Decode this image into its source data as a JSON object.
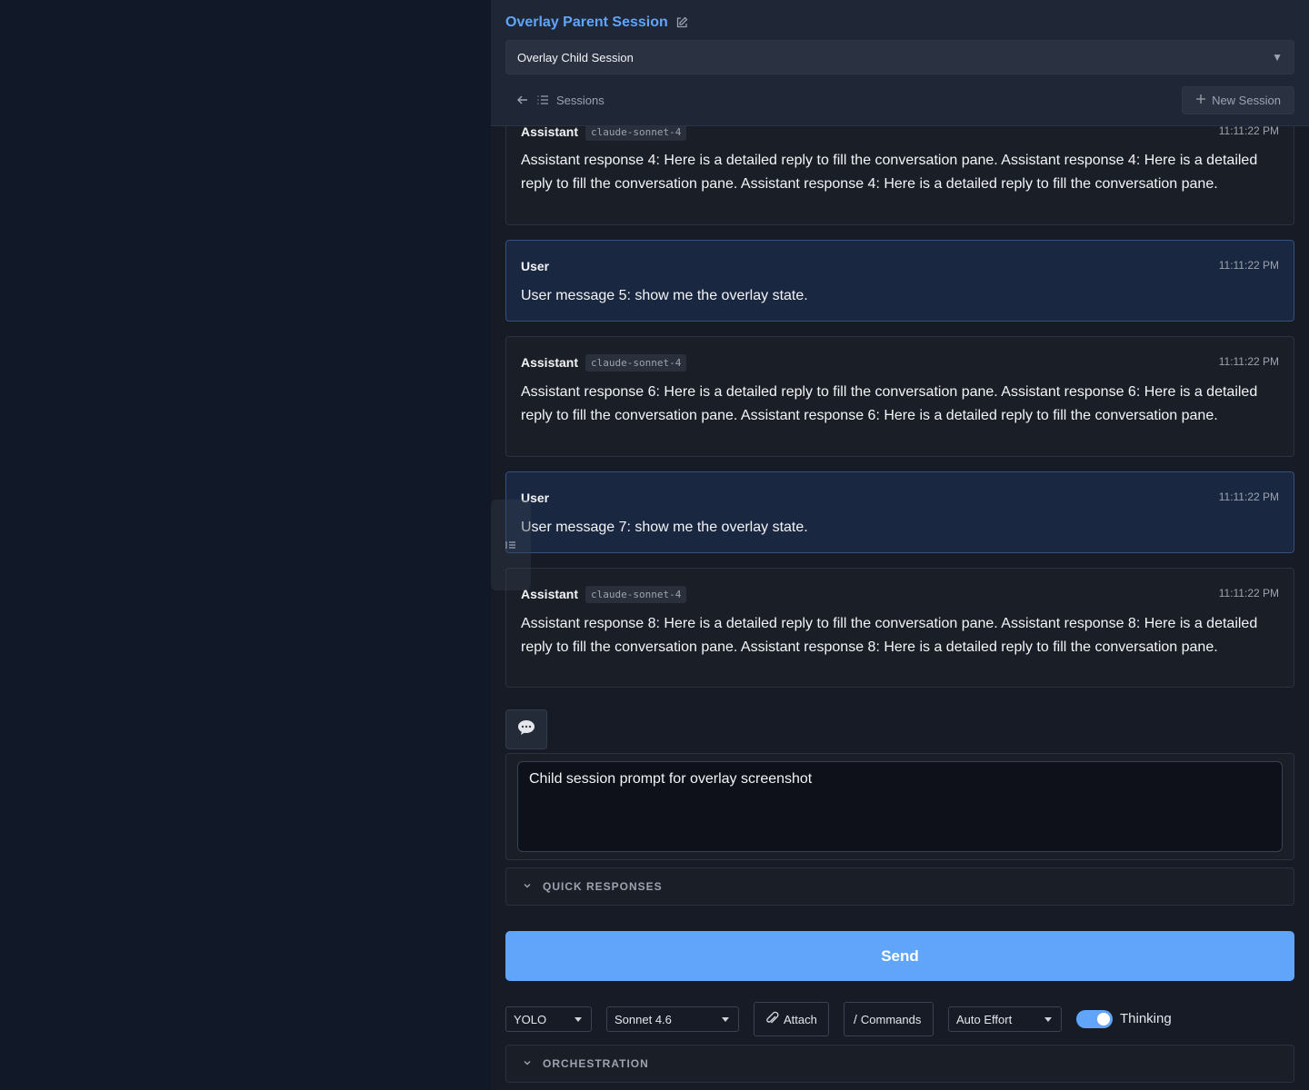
{
  "header": {
    "title": "Overlay Parent Session",
    "selected_session": "Overlay Child Session",
    "sessions_label": "Sessions",
    "new_session_label": "New Session"
  },
  "messages": [
    {
      "role": "Assistant",
      "model": "claude-sonnet-4",
      "time": "11:11:22 PM",
      "text": "Assistant response 4: Here is a detailed reply to fill the conversation pane. Assistant response 4: Here is a detailed reply to fill the conversation pane. Assistant response 4: Here is a detailed reply to fill the conversation pane."
    },
    {
      "role": "User",
      "time": "11:11:22 PM",
      "text": "User message 5: show me the overlay state."
    },
    {
      "role": "Assistant",
      "model": "claude-sonnet-4",
      "time": "11:11:22 PM",
      "text": "Assistant response 6: Here is a detailed reply to fill the conversation pane. Assistant response 6: Here is a detailed reply to fill the conversation pane. Assistant response 6: Here is a detailed reply to fill the conversation pane."
    },
    {
      "role": "User",
      "time": "11:11:22 PM",
      "text": "User message 7: show me the overlay state."
    },
    {
      "role": "Assistant",
      "model": "claude-sonnet-4",
      "time": "11:11:22 PM",
      "text": "Assistant response 8: Here is a detailed reply to fill the conversation pane. Assistant response 8: Here is a detailed reply to fill the conversation pane. Assistant response 8: Here is a detailed reply to fill the conversation pane."
    }
  ],
  "composer": {
    "prompt_value": "Child session prompt for overlay screenshot",
    "quick_responses_label": "QUICK RESPONSES",
    "send_label": "Send",
    "orchestration_label": "ORCHESTRATION"
  },
  "toolbar": {
    "mode": "YOLO",
    "model": "Sonnet 4.6",
    "attach_label": "Attach",
    "commands_label": "Commands",
    "effort": "Auto Effort",
    "thinking_label": "Thinking",
    "thinking_on": true
  },
  "colors": {
    "accent": "#60a5fa",
    "background": "#111827",
    "user_bubble": "#1a2740"
  }
}
